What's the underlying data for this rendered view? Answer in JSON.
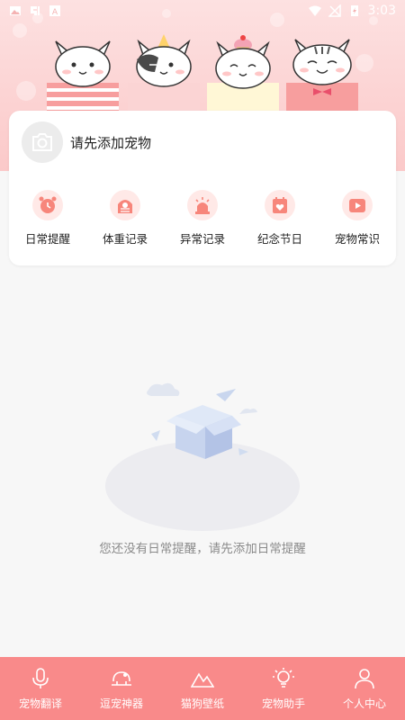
{
  "status_bar": {
    "time": "3:03",
    "left_icons": [
      "image-icon",
      "app-icon",
      "text-icon"
    ],
    "right_icons": [
      "wifi-icon",
      "no-signal-icon",
      "battery-charging-icon"
    ]
  },
  "header": {
    "add_pet_text": "请先添加宠物",
    "avatar_icon": "camera-icon"
  },
  "functions": [
    {
      "label": "日常提醒",
      "icon": "alarm-clock-icon"
    },
    {
      "label": "体重记录",
      "icon": "scale-icon"
    },
    {
      "label": "异常记录",
      "icon": "siren-icon"
    },
    {
      "label": "纪念节日",
      "icon": "calendar-heart-icon"
    },
    {
      "label": "宠物常识",
      "icon": "video-play-icon"
    }
  ],
  "empty_state": {
    "message": "您还没有日常提醒，请先添加日常提醒",
    "illustration": "empty-box-illustration"
  },
  "bottom_nav": [
    {
      "label": "宠物翻译",
      "icon": "microphone-icon"
    },
    {
      "label": "逗宠神器",
      "icon": "pet-toy-icon"
    },
    {
      "label": "猫狗壁纸",
      "icon": "mountain-icon"
    },
    {
      "label": "宠物助手",
      "icon": "bulb-icon"
    },
    {
      "label": "个人中心",
      "icon": "person-icon"
    }
  ],
  "colors": {
    "accent": "#f98a8a",
    "icon_bg": "#ffe9e7",
    "hero_top": "#fde1e1",
    "hero_bottom": "#fbc9c9"
  }
}
